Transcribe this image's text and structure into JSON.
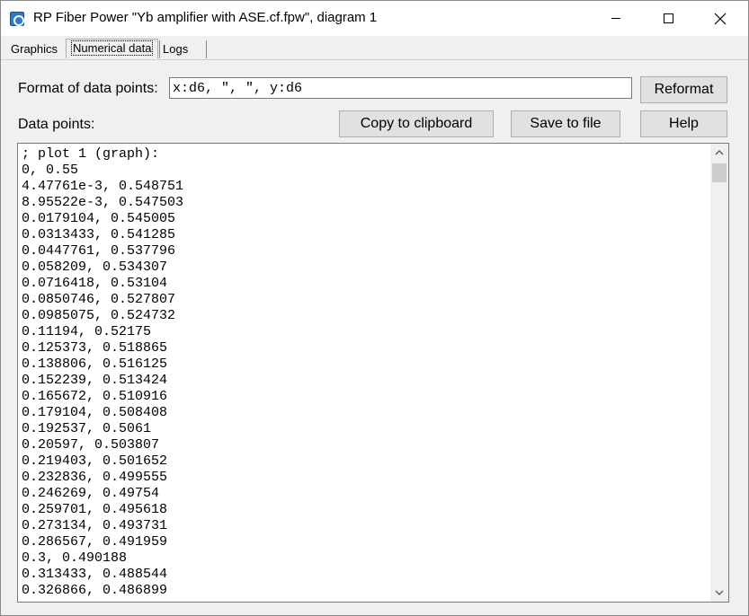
{
  "window": {
    "title": "RP Fiber Power \"Yb amplifier with ASE.cf.fpw\", diagram 1",
    "controls": {
      "minimize": "minimize",
      "maximize": "maximize",
      "close": "close"
    }
  },
  "tabs": [
    {
      "label": "Graphics",
      "active": false
    },
    {
      "label": "Numerical data",
      "active": true
    },
    {
      "label": "Logs",
      "active": false
    }
  ],
  "format": {
    "label": "Format of data points:",
    "value": "x:d6, \", \", y:d6",
    "reformat_label": "Reformat"
  },
  "data_points": {
    "label": "Data points:",
    "copy_label": "Copy to clipboard",
    "save_label": "Save to file",
    "help_label": "Help",
    "lines": [
      "; plot 1 (graph):",
      "0, 0.55",
      "4.47761e-3, 0.548751",
      "8.95522e-3, 0.547503",
      "0.0179104, 0.545005",
      "0.0313433, 0.541285",
      "0.0447761, 0.537796",
      "0.058209, 0.534307",
      "0.0716418, 0.53104",
      "0.0850746, 0.527807",
      "0.0985075, 0.524732",
      "0.11194, 0.52175",
      "0.125373, 0.518865",
      "0.138806, 0.516125",
      "0.152239, 0.513424",
      "0.165672, 0.510916",
      "0.179104, 0.508408",
      "0.192537, 0.5061",
      "0.20597, 0.503807",
      "0.219403, 0.501652",
      "0.232836, 0.499555",
      "0.246269, 0.49754",
      "0.259701, 0.495618",
      "0.273134, 0.493731",
      "0.286567, 0.491959",
      "0.3, 0.490188",
      "0.313433, 0.488544",
      "0.326866, 0.486899"
    ]
  }
}
